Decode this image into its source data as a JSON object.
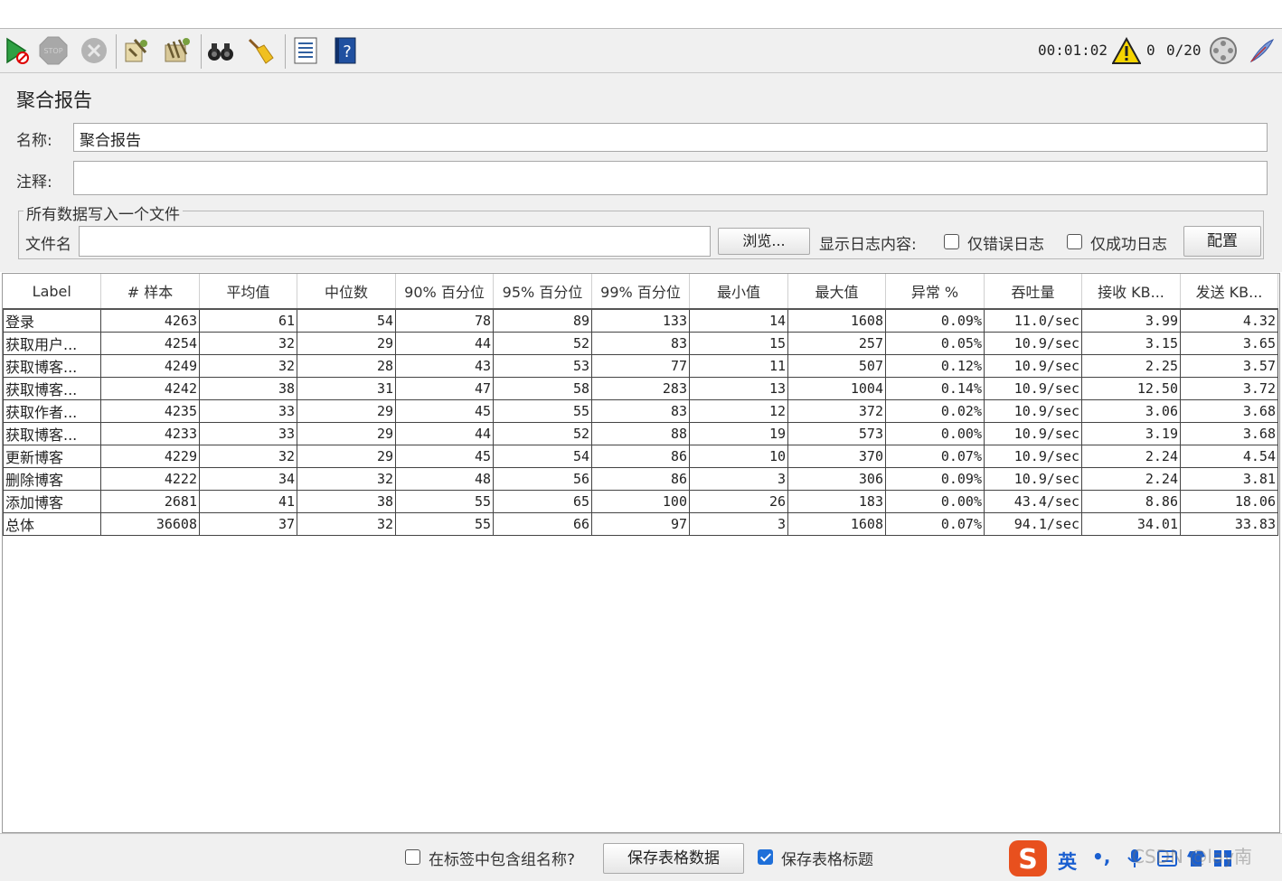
{
  "toolbar": {
    "elapsed": "00:01:02",
    "warning_count": "0",
    "threads": "0/20"
  },
  "panel": {
    "title": "聚合报告",
    "name_label": "名称:",
    "name_value": "聚合报告",
    "comment_label": "注释:",
    "comment_value": "",
    "file_group_title": "所有数据写入一个文件",
    "file_label": "文件名",
    "file_value": "",
    "browse_button": "浏览...",
    "log_content_label": "显示日志内容:",
    "errors_only_label": "仅错误日志",
    "success_only_label": "仅成功日志",
    "configure_button": "配置"
  },
  "table": {
    "headers": [
      "Label",
      "# 样本",
      "平均值",
      "中位数",
      "90% 百分位",
      "95% 百分位",
      "99% 百分位",
      "最小值",
      "最大值",
      "异常 %",
      "吞吐量",
      "接收 KB...",
      "发送 KB..."
    ],
    "rows": [
      [
        "登录",
        "4263",
        "61",
        "54",
        "78",
        "89",
        "133",
        "14",
        "1608",
        "0.09%",
        "11.0/sec",
        "3.99",
        "4.32"
      ],
      [
        "获取用户...",
        "4254",
        "32",
        "29",
        "44",
        "52",
        "83",
        "15",
        "257",
        "0.05%",
        "10.9/sec",
        "3.15",
        "3.65"
      ],
      [
        "获取博客...",
        "4249",
        "32",
        "28",
        "43",
        "53",
        "77",
        "11",
        "507",
        "0.12%",
        "10.9/sec",
        "2.25",
        "3.57"
      ],
      [
        "获取博客...",
        "4242",
        "38",
        "31",
        "47",
        "58",
        "283",
        "13",
        "1004",
        "0.14%",
        "10.9/sec",
        "12.50",
        "3.72"
      ],
      [
        "获取作者...",
        "4235",
        "33",
        "29",
        "45",
        "55",
        "83",
        "12",
        "372",
        "0.02%",
        "10.9/sec",
        "3.06",
        "3.68"
      ],
      [
        "获取博客...",
        "4233",
        "33",
        "29",
        "44",
        "52",
        "88",
        "19",
        "573",
        "0.00%",
        "10.9/sec",
        "3.19",
        "3.68"
      ],
      [
        "更新博客",
        "4229",
        "32",
        "29",
        "45",
        "54",
        "86",
        "10",
        "370",
        "0.07%",
        "10.9/sec",
        "2.24",
        "4.54"
      ],
      [
        "删除博客",
        "4222",
        "34",
        "32",
        "48",
        "56",
        "86",
        "3",
        "306",
        "0.09%",
        "10.9/sec",
        "2.24",
        "3.81"
      ],
      [
        "添加博客",
        "2681",
        "41",
        "38",
        "55",
        "65",
        "100",
        "26",
        "183",
        "0.00%",
        "43.4/sec",
        "8.86",
        "18.06"
      ],
      [
        "总体",
        "36608",
        "37",
        "32",
        "55",
        "66",
        "97",
        "3",
        "1608",
        "0.07%",
        "94.1/sec",
        "34.01",
        "33.83"
      ]
    ]
  },
  "footer": {
    "include_group_label": "在标签中包含组名称?",
    "include_group_checked": false,
    "save_table_button": "保存表格数据",
    "save_header_label": "保存表格标题",
    "save_header_checked": true
  },
  "ime": {
    "mode_label": "英",
    "punct": "•,",
    "watermark": "CSDN @lay南"
  },
  "colors": {
    "toolbar_bg": "#f0f0f0",
    "checkbox_checked": "#1e6fd9",
    "ime_brand": "#e8501e"
  }
}
